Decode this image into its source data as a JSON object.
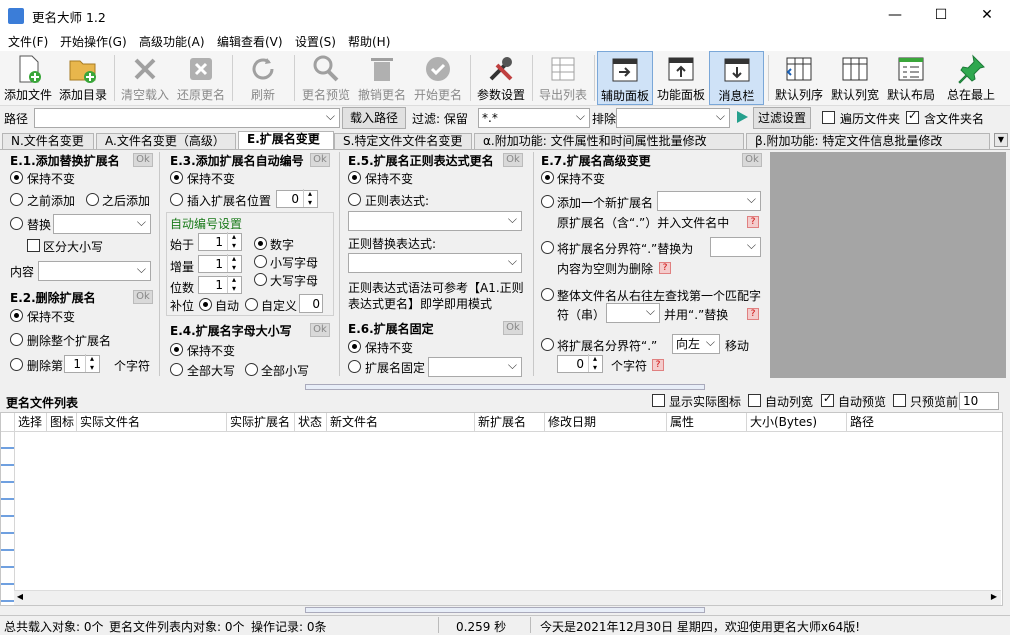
{
  "window": {
    "title": "更名大师 1.2"
  },
  "menu": [
    "文件(F)",
    "开始操作(G)",
    "高级功能(A)",
    "编辑查看(V)",
    "设置(S)",
    "帮助(H)"
  ],
  "toolbar": {
    "add_file": "添加文件",
    "add_dir": "添加目录",
    "clear_load": "清空载入",
    "restore_name": "还原更名",
    "refresh": "刷新",
    "preview": "更名预览",
    "undo": "撤销更名",
    "start": "开始更名",
    "params": "参数设置",
    "export": "导出列表",
    "aux_panel": "辅助面板",
    "func_panel": "功能面板",
    "msg_bar": "消息栏",
    "default_order": "默认列序",
    "default_width": "默认列宽",
    "default_layout": "默认布局",
    "always_top": "总在最上"
  },
  "pathbar": {
    "path_label": "路径",
    "load_path": "载入路径",
    "filter_label": "过滤: 保留",
    "filter_value": "*.*",
    "exclude_label": "排除",
    "filter_settings": "过滤设置",
    "traverse": "遍历文件夹",
    "include_dir": "含文件夹名"
  },
  "tabs": [
    "N.文件名变更",
    "A.文件名变更（高级）",
    "E.扩展名变更",
    "S.特定文件文件名变更",
    "α.附加功能: 文件属性和时间属性批量修改",
    "β.附加功能: 特定文件信息批量修改"
  ],
  "panel": {
    "ok": "Ok",
    "e1": {
      "title": "E.1.添加替换扩展名",
      "keep": "保持不变",
      "before": "之前添加",
      "after": "之后添加",
      "replace": "替换",
      "case": "区分大小写",
      "content": "内容"
    },
    "e2": {
      "title": "E.2.删除扩展名",
      "keep": "保持不变",
      "delete_all": "删除整个扩展名",
      "delete_nth": "删除第",
      "nth_value": "1",
      "nth_suffix": "个字符"
    },
    "e3": {
      "title": "E.3.添加扩展名自动编号",
      "keep": "保持不变",
      "insert": "插入扩展名位置",
      "insert_pos": "0",
      "auto_settings": "自动编号设置",
      "start": "始于",
      "start_val": "1",
      "step": "增量",
      "step_val": "1",
      "digits": "位数",
      "digits_val": "1",
      "num": "数字",
      "lower": "小写字母",
      "upper": "大写字母",
      "pad": "补位",
      "pad_auto": "自动",
      "pad_custom": "自定义",
      "pad_val": "0"
    },
    "e4": {
      "title": "E.4.扩展名字母大小写",
      "keep": "保持不变",
      "all_upper": "全部大写",
      "all_lower": "全部小写"
    },
    "e5": {
      "title": "E.5.扩展名正则表达式更名",
      "keep": "保持不变",
      "regex": "正则表达式:",
      "regex_replace": "正则替换表达式:",
      "note": "正则表达式语法可参考【A1.正则表达式更名】即学即用模式"
    },
    "e6": {
      "title": "E.6.扩展名固定",
      "keep": "保持不变",
      "fixed": "扩展名固定"
    },
    "e7": {
      "title": "E.7.扩展名高级变更",
      "keep": "保持不变",
      "add_new": "添加一个新扩展名",
      "orig_merge": "原扩展名（含“.”）并入文件名中",
      "sep_replace": "将扩展名分界符“.”替换为",
      "empty_delete": "内容为空则为删除",
      "search_rl": "整体文件名从右往左查找第一个匹配字",
      "str_label": "符（串）",
      "and_replace": "并用“.”替换",
      "sep_move": "将扩展名分界符“.”",
      "dir": "向左",
      "move": "移动",
      "move_val": "0",
      "chars": "个字符",
      "help": "?"
    }
  },
  "list": {
    "title": "更名文件列表",
    "show_icon": "显示实际图标",
    "auto_width": "自动列宽",
    "auto_preview": "自动预览",
    "only_preview": "只预览前",
    "preview_n": "10",
    "columns": [
      "选择",
      "图标",
      "实际文件名",
      "实际扩展名",
      "状态",
      "新文件名",
      "新扩展名",
      "修改日期",
      "属性",
      "大小(Bytes)",
      "路径"
    ]
  },
  "status": {
    "loaded": "总共载入对象: 0个",
    "in_list": "更名文件列表内对象: 0个",
    "records": "操作记录: 0条",
    "time": "0.259 秒",
    "welcome": "今天是2021年12月30日 星期四，欢迎使用更名大师x64版!"
  }
}
